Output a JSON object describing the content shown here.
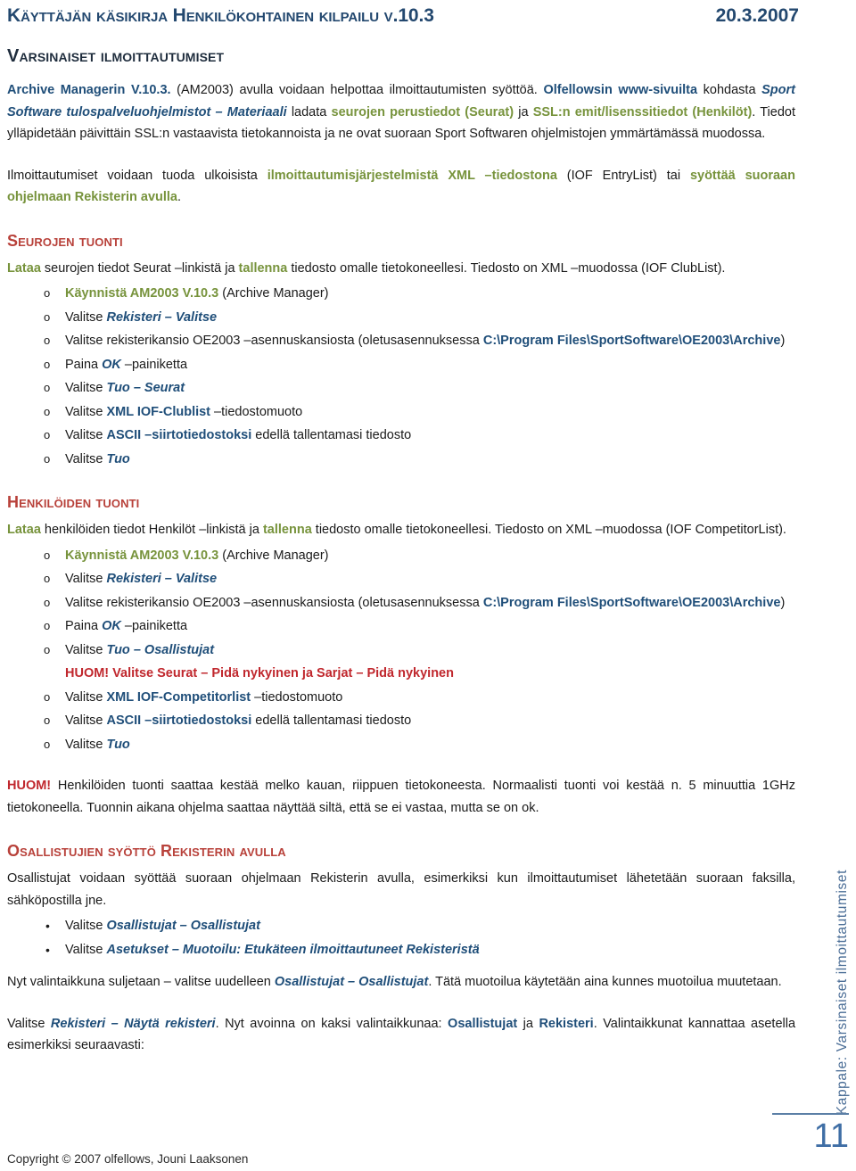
{
  "header": {
    "title": "Käyttäjän käsikirja Henkilökohtainen kilpailu v.10.3",
    "date": "20.3.2007"
  },
  "headings": {
    "main": "Varsinaiset ilmoittautumiset",
    "seurojen_tuonti": "Seurojen tuonti",
    "henkiloiden_tuonti": "Henkilöiden tuonti",
    "osallistujien_syotto": "Osallistujien syöttö Rekisterin avulla"
  },
  "intro": {
    "p1_a": "Archive Managerin V.10.3.",
    "p1_b": " (AM2003) avulla voidaan helpottaa ilmoittautumisten syöttöä. ",
    "p1_c": "Olfellowsin www-sivuilta",
    "p1_d": " kohdasta ",
    "p1_e": "Sport Software tulospalveluohjelmistot – Materiaali",
    "p1_f": " ladata ",
    "p1_g": "seurojen perustiedot (Seurat)",
    "p1_h": " ja ",
    "p1_i": "SSL:n emit/lisenssitiedot (Henkilöt)",
    "p1_j": ". Tiedot ylläpidetään päivittäin SSL:n vastaavista tietokannoista ja ne ovat suoraan Sport Softwaren ohjelmistojen ymmärtämässä muodossa.",
    "p2_a": "Ilmoittautumiset voidaan tuoda ulkoisista ",
    "p2_b": "ilmoittautumisjärjestelmistä XML –tiedostona",
    "p2_c": " (IOF EntryList) tai ",
    "p2_d": "syöttää suoraan ohjelmaan Rekisterin avulla",
    "p2_e": "."
  },
  "seurojen_tuonti": {
    "intro_a": "Lataa",
    "intro_b": " seurojen tiedot Seurat –linkistä ja ",
    "intro_c": "tallenna",
    "intro_d": " tiedosto omalle tietokoneellesi. Tiedosto on XML –muodossa (IOF ClubList).",
    "steps": [
      {
        "bullet": "o",
        "pre": "",
        "em": "Käynnistä AM2003 V.10.3",
        "em_style": "olive",
        "post": " (Archive Manager)"
      },
      {
        "bullet": "o",
        "pre": "Valitse ",
        "em": "Rekisteri – Valitse",
        "em_style": "blue-i",
        "post": ""
      },
      {
        "bullet": "o",
        "pre": "Valitse rekisterikansio OE2003 –asennuskansiosta (oletusasennuksessa ",
        "em": "C:\\Program Files\\SportSoftware\\OE2003\\Archive",
        "em_style": "blue",
        "post": ")",
        "justify": true
      },
      {
        "bullet": "o",
        "pre": "Paina ",
        "em": "OK",
        "em_style": "blue-i",
        "post": " –painiketta"
      },
      {
        "bullet": "o",
        "pre": "Valitse ",
        "em": "Tuo – Seurat",
        "em_style": "blue-i",
        "post": ""
      },
      {
        "bullet": "o",
        "pre": "Valitse ",
        "em": "XML IOF-Clublist",
        "em_style": "blue",
        "post": " –tiedostomuoto"
      },
      {
        "bullet": "o",
        "pre": "Valitse ",
        "em": "ASCII –siirtotiedostoksi",
        "em_style": "blue",
        "post": " edellä tallentamasi tiedosto"
      },
      {
        "bullet": "o",
        "pre": "Valitse ",
        "em": "Tuo",
        "em_style": "blue-i",
        "post": ""
      }
    ]
  },
  "henkiloiden_tuonti": {
    "intro_a": "Lataa",
    "intro_b": " henkilöiden tiedot Henkilöt –linkistä ja ",
    "intro_c": "tallenna",
    "intro_d": " tiedosto omalle tietokoneellesi. Tiedosto on XML –muodossa (IOF CompetitorList).",
    "steps": [
      {
        "bullet": "o",
        "pre": "",
        "em": "Käynnistä AM2003 V.10.3",
        "em_style": "olive",
        "post": " (Archive Manager)"
      },
      {
        "bullet": "o",
        "pre": "Valitse ",
        "em": "Rekisteri – Valitse",
        "em_style": "blue-i",
        "post": ""
      },
      {
        "bullet": "o",
        "pre": "Valitse rekisterikansio OE2003 –asennuskansiosta (oletusasennuksessa ",
        "em": "C:\\Program Files\\SportSoftware\\OE2003\\Archive",
        "em_style": "blue",
        "post": ")",
        "justify": true
      },
      {
        "bullet": "o",
        "pre": "Paina ",
        "em": "OK",
        "em_style": "blue-i",
        "post": " –painiketta"
      },
      {
        "bullet": "o",
        "pre": "Valitse ",
        "em": "Tuo – Osallistujat",
        "em_style": "blue-i",
        "post": ""
      },
      {
        "bullet": "o",
        "pre": "Valitse ",
        "em": "XML IOF-Competitorlist",
        "em_style": "blue",
        "post": " –tiedostomuoto"
      },
      {
        "bullet": "o",
        "pre": "Valitse ",
        "em": "ASCII –siirtotiedostoksi",
        "em_style": "blue",
        "post": " edellä tallentamasi tiedosto"
      },
      {
        "bullet": "o",
        "pre": "Valitse ",
        "em": "Tuo",
        "em_style": "blue-i",
        "post": ""
      }
    ],
    "huom_inline": "HUOM! Valitse Seurat – Pidä nykyinen ja Sarjat – Pidä nykyinen",
    "huom_a": "HUOM!",
    "huom_b": " Henkilöiden tuonti saattaa kestää melko kauan, riippuen tietokoneesta. Normaalisti tuonti voi kestää n. 5 minuuttia 1GHz tietokoneella. Tuonnin aikana ohjelma saattaa näyttää siltä, että se ei vastaa, mutta se on ok."
  },
  "osallistujien_syotto": {
    "intro": "Osallistujat voidaan syöttää suoraan ohjelmaan Rekisterin avulla, esimerkiksi kun ilmoittautumiset lähetetään suoraan faksilla, sähköpostilla jne.",
    "steps": [
      {
        "bullet": "•",
        "pre": "Valitse ",
        "em": "Osallistujat – Osallistujat",
        "em_style": "blue-i",
        "post": ""
      },
      {
        "bullet": "•",
        "pre": "Valitse ",
        "em": "Asetukset – Muotoilu: Etukäteen ilmoittautuneet Rekisteristä",
        "em_style": "blue-i",
        "post": ""
      }
    ],
    "after_a": "Nyt valintaikkuna suljetaan – valitse uudelleen ",
    "after_b": "Osallistujat – Osallistujat",
    "after_c": ". Tätä muotoilua käytetään aina kunnes muotoilua muutetaan.",
    "last_a": "Valitse ",
    "last_b": "Rekisteri – Näytä rekisteri",
    "last_c": ". Nyt avoinna on kaksi valintaikkunaa: ",
    "last_d": "Osallistujat",
    "last_e": " ja ",
    "last_f": "Rekisteri",
    "last_g": ". Valintaikkunat kannattaa asetella esimerkiksi seuraavasti:"
  },
  "side_tab": {
    "label": "Kappale: Varsinaiset ilmoittautumiset"
  },
  "page_number": "11",
  "footer": {
    "copyright": "Copyright © 2007 olfellows, Jouni Laaksonen"
  },
  "colors": {
    "header_blue": "#23486f",
    "link_blue": "#1f4e79",
    "olive": "#77933c",
    "red": "#c0272d",
    "side_tab_blue": "#4a6d96",
    "page_number_blue": "#3f6ea5"
  }
}
